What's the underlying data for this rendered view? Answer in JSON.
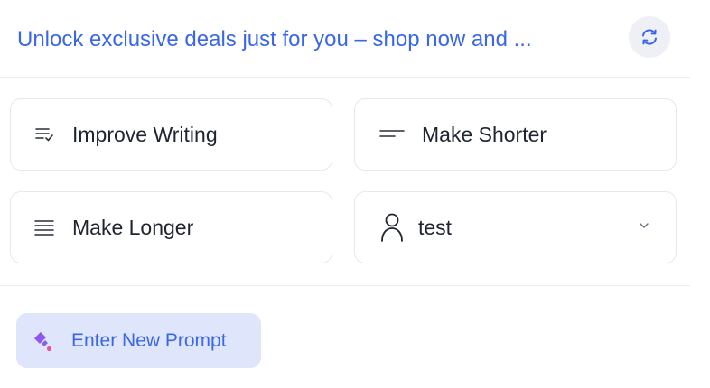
{
  "suggestion": {
    "text": "Unlock exclusive deals just for you – shop now and ...",
    "refresh_icon": "refresh-icon"
  },
  "actions": [
    {
      "label": "Improve Writing",
      "icon": "text-check-icon"
    },
    {
      "label": "Make Shorter",
      "icon": "short-lines-icon"
    },
    {
      "label": "Make Longer",
      "icon": "long-lines-icon"
    }
  ],
  "persona_select": {
    "value": "test",
    "icon": "user-icon",
    "dropdown_icon": "chevron-down-icon"
  },
  "prompt_button": {
    "label": "Enter New Prompt",
    "icon": "magic-wand-icon"
  },
  "colors": {
    "accent": "#3a67e8",
    "button_bg": "#dfe6fb",
    "card_border": "#e6e8ec"
  }
}
